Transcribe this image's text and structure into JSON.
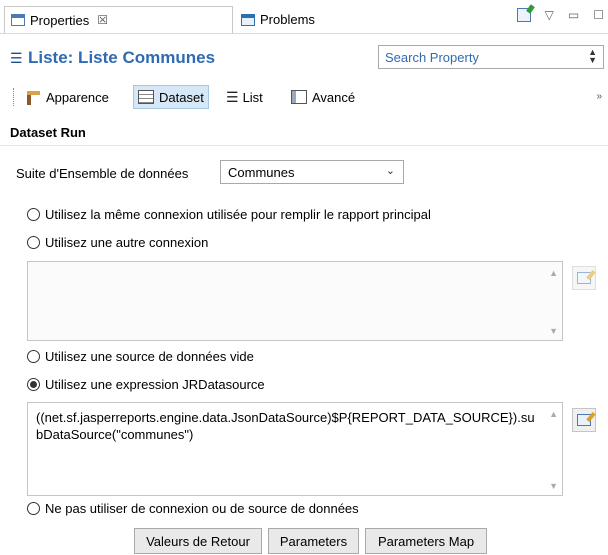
{
  "tabs": [
    {
      "label": "Properties",
      "close": "☒",
      "active": true
    },
    {
      "label": "Problems",
      "active": false
    }
  ],
  "view_controls": {
    "minimize": "▽",
    "restore": "▭",
    "maximize": "☐"
  },
  "header": {
    "icon": "list-icon",
    "title": "Liste: Liste Communes",
    "search_placeholder": "Search Property"
  },
  "subtabs": [
    {
      "label": "Apparence",
      "icon": "apparence-icon"
    },
    {
      "label": "Dataset",
      "icon": "dataset-icon",
      "active": true
    },
    {
      "label": "List",
      "icon": "list-icon"
    },
    {
      "label": "Avancé",
      "icon": "table-icon"
    }
  ],
  "more_glyph": "»",
  "section": {
    "title": "Dataset Run",
    "dataset_label": "Suite d'Ensemble de données",
    "dataset_value": "Communes"
  },
  "radios": {
    "same_connection": "Utilisez la même connexion utilisée pour remplir le rapport principal",
    "other_connection": "Utilisez une autre connexion",
    "empty_datasource": "Utilisez une source de données vide",
    "jr_expression": "Utilisez une expression JRDatasource",
    "none": "Ne pas utiliser de connexion ou de source de données"
  },
  "selected_radio": "jr_expression",
  "connection_expression": "",
  "datasource_expression": "((net.sf.jasperreports.engine.data.JsonDataSource)$P{REPORT_DATA_SOURCE}).subDataSource(\"communes\")",
  "buttons": {
    "return_values": "Valeurs de Retour",
    "parameters": "Parameters",
    "parameters_map": "Parameters Map"
  }
}
